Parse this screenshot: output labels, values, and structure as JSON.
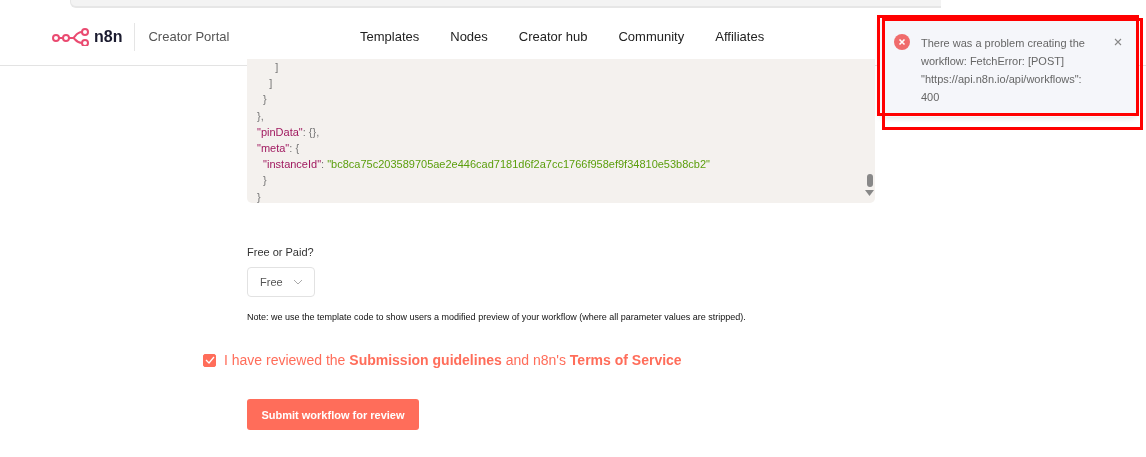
{
  "header": {
    "logo_text": "n8n",
    "portal": "Creator Portal",
    "nav": [
      {
        "label": "Templates"
      },
      {
        "label": "Nodes"
      },
      {
        "label": "Creator hub"
      },
      {
        "label": "Community"
      },
      {
        "label": "Affiliates"
      }
    ]
  },
  "code": {
    "lines": [
      [
        {
          "kind": "punct",
          "text": "      ]"
        }
      ],
      [
        {
          "kind": "punct",
          "text": "    ]"
        }
      ],
      [
        {
          "kind": "punct",
          "text": "  }"
        }
      ],
      [
        {
          "kind": "punct",
          "text": "},"
        }
      ],
      [
        {
          "kind": "key",
          "text": "\"pinData\""
        },
        {
          "kind": "punct",
          "text": ": {},"
        }
      ],
      [
        {
          "kind": "key",
          "text": "\"meta\""
        },
        {
          "kind": "punct",
          "text": ": {"
        }
      ],
      [
        {
          "kind": "key",
          "text": "  \"instanceId\""
        },
        {
          "kind": "punct",
          "text": ": "
        },
        {
          "kind": "string",
          "text": "\"bc8ca75c203589705ae2e446cad7181d6f2a7cc1766f958ef9f34810e53b8cb2\""
        }
      ],
      [
        {
          "kind": "punct",
          "text": "  }"
        }
      ],
      [
        {
          "kind": "punct",
          "text": "}"
        }
      ]
    ]
  },
  "pricing": {
    "label": "Free or Paid?",
    "value": "Free",
    "note": "Note: we use the template code to show users a modified preview of your workflow (where all parameter values are stripped)."
  },
  "agreement": {
    "checked": true,
    "text": "I have reviewed the **Submission guidelines** and n8n's **Terms of Service**"
  },
  "submit_button": "Submit workflow for review",
  "toast": {
    "kind": "error",
    "message": "There was a problem creating the workflow: FetchError: [POST] \"https://api.n8n.io/api/workflows\": 400"
  }
}
